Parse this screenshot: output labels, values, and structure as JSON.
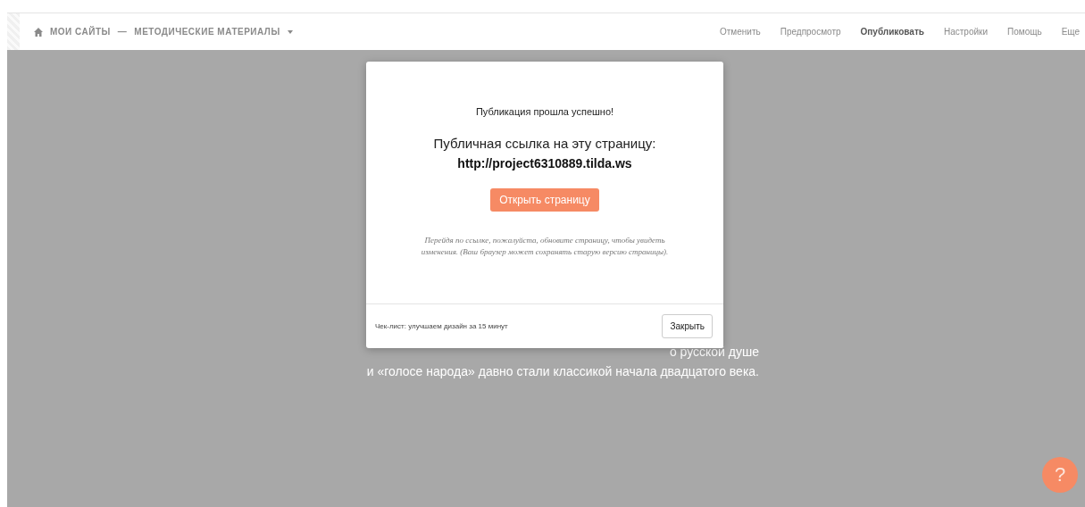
{
  "header": {
    "breadcrumb": [
      {
        "label": "МОИ САЙТЫ"
      },
      {
        "label": "—"
      },
      {
        "label": "МЕТОДИЧЕСКИЕ МАТЕРИАЛЫ"
      }
    ],
    "actions": [
      {
        "label": "Отменить",
        "bold": false
      },
      {
        "label": "Предпросмотр",
        "bold": false
      },
      {
        "label": "Опубликовать",
        "bold": true
      },
      {
        "label": "Настройки",
        "bold": false
      },
      {
        "label": "Помощь",
        "bold": false
      },
      {
        "label": "Еще",
        "bold": false
      }
    ]
  },
  "page": {
    "lines": [
      "о русской душе",
      "и «голосе народа» давно стали классикой начала двадцатого века."
    ]
  },
  "modal": {
    "status": "Публикация прошла успешно!",
    "link_caption": "Публичная ссылка на эту страницу:",
    "link": "http://project6310889.tilda.ws",
    "open_button": "Открыть страницу",
    "note": "Перейдя по ссылке, пожалуйста, обновите страницу, чтобы увидеть изменения. (Ваш браузер может сохранять старую версию страницы).",
    "footer_link": "Чек-лист: улучшаем дизайн за 15 минут",
    "close_button": "Закрыть"
  },
  "help_button": "?"
}
